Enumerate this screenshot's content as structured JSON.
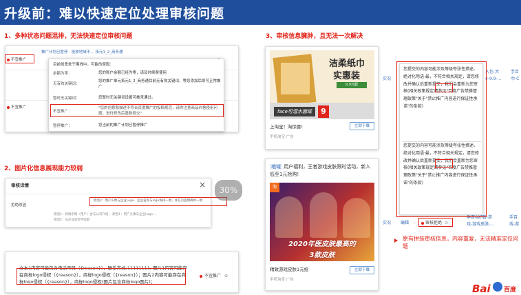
{
  "header": {
    "title": "升级前：难以快速定位处理审核问题"
  },
  "sections": {
    "s1": "1、多种状态问题混排，无法快速定位审核问题",
    "s2": "2、图片化信息展现能力较弱",
    "s3": "3、审核信息臃肿，且无法一次解决"
  },
  "panel1": {
    "top_link": "推广计划已暂停 · 投放地域不…  拓元1_2_商务通",
    "status_1": "不宜推广",
    "status_2": "不宜推广",
    "zero_1": "0",
    "zero_2": "0",
    "popup": {
      "intro": "目前创意处于离线中，可能的原因：",
      "rows": [
        {
          "label": "余额为零：",
          "value": "您的账户余额已经为零，请及时续费使用"
        },
        {
          "label": "无有效关键词：",
          "value": "您的推广单元拓元1_2_商务通目前无有效关键词，等您添加后即可正常推广"
        },
        {
          "label": "暂时无关键词：",
          "value": "您暂时无关键词设置可推来通过。"
        },
        {
          "label": "不宜推广：",
          "value": "\"您的创意和描述不符合百度推广的投稿规范，请你注意商品价格使用问题，进行修改后重新提交\""
        },
        {
          "label": "暂停推广：",
          "value": "您当前的推广计划已暂停推广"
        }
      ]
    }
  },
  "panel2": {
    "dialog_title": "审核详情",
    "close_glyph": "×",
    "col_label": "拒绝原因",
    "hint_main": "原因2：用户头像与企业Logo、企业名称与logo保持一致，并在页面明确中一致",
    "hint_sub1": "原因1：商请示例（用户）合与公司介绍…  原因1：用户头像与企业Logo…",
    "hint_sub2": "原因2：与企业资料不匹配",
    "overlay_pct": "30%",
    "reason_text": "文本1内容可能包含电话号码（{reason}），联系方式:11111111; 图片1内容可能存在商标logo侵权（{reason}），商标logo侵权（{reason}）；图片2内容可能存在商标logo侵权（{reason}），商标logo侵权(图片包含商标logo图片)；",
    "status": "不宜推广",
    "status_icon": "⊕"
  },
  "panel3": {
    "ad1": {
      "headline_1": "洁柔纸巾",
      "headline_2": "实惠装",
      "badge": "9.9元起",
      "watermark": "face可湿水面纸",
      "price": "9",
      "title": "上淘宝！淘惊喜!",
      "source": "手机淘宝 广告",
      "button": "立即下载"
    },
    "ad2": {
      "tag": "地域",
      "headline": "用户福利，王者游戏皮肤限时活动，新人低至1元抢购!",
      "banner_1": "2020年医皮肤最高的",
      "banner_2": "3款皮肤",
      "title": "精致游戏皮肤1元抢",
      "source": "手机淘宝 广告",
      "button": "立即下载"
    },
    "left_cut_1": "实况",
    "left_cut_2": "实况",
    "right_cut": {
      "top_1": "入包-大",
      "top_2": "4-9.9-...",
      "top_3": "手百",
      "top_4": "巾-C",
      "bot_1": "手百&好看-游",
      "bot_2": "戏-游戏皮肤-...",
      "bot_3": "手百",
      "bot_4": "戏-游"
    },
    "toolbar": {
      "edit": "编辑",
      "dash": "—",
      "status": "审核拒绝",
      "icon": "⊙"
    },
    "review_text": "您提交的内容可能涉及等级夸张性措述、绝对化用语·最，不符合相关规定，请您修改并确认后重新提交，我们会重新为您审核(相关政策规定请参见\"百度广告禁推管理政策\"关于\"禁止推广内容进行保证性承诺\"的条款)",
    "highlight_word": "用语·最",
    "callout": "原有拼装审核信息，内容重复，无法精准定位问题",
    "logo_text": "Bai",
    "logo_cn": "百度"
  },
  "colors": {
    "banner": "#1f4e9c",
    "accent": "#e1251b",
    "link": "#3b6fb6"
  }
}
